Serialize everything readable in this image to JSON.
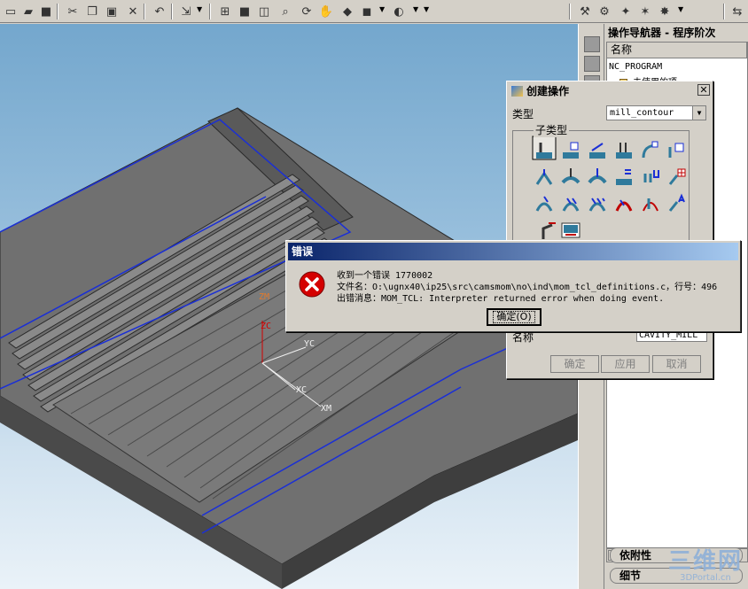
{
  "navigator": {
    "title": "操作导航器 - 程序阶次",
    "column_header": "名称",
    "items": [
      "NC_PROGRAM",
      "未使用的项"
    ],
    "tabs": [
      "依附性",
      "细节"
    ]
  },
  "op_dialog": {
    "title": "创建操作",
    "type_label": "类型",
    "type_value": "mill_contour",
    "subtype_label": "子类型",
    "name_label": "名称",
    "name_value": "CAVITY_MILL",
    "ok_label": "确定",
    "apply_label": "应用",
    "cancel_label": "取消"
  },
  "error_dialog": {
    "title": "错误",
    "line1": "收到一个错误 1770002",
    "line2": "文件名：O:\\ugnx40\\ip25\\src\\camsmom\\no\\ind\\mom_tcl_definitions.c，行号：496",
    "line3": "出错消息：MOM_TCL: Interpreter returned error when doing event.",
    "ok_label": "确定(O)"
  },
  "viewport": {
    "axis_labels": [
      "ZM",
      "ZC",
      "YC",
      "XC",
      "XM"
    ]
  },
  "watermark": {
    "text": "三维网",
    "subtext": "3DPortal.cn"
  },
  "colors": {
    "title_bar_active": "#0a246a",
    "error_red": "#d40000",
    "edge_blue": "#1a2fd6",
    "part_gray": "#6b6b6b"
  }
}
